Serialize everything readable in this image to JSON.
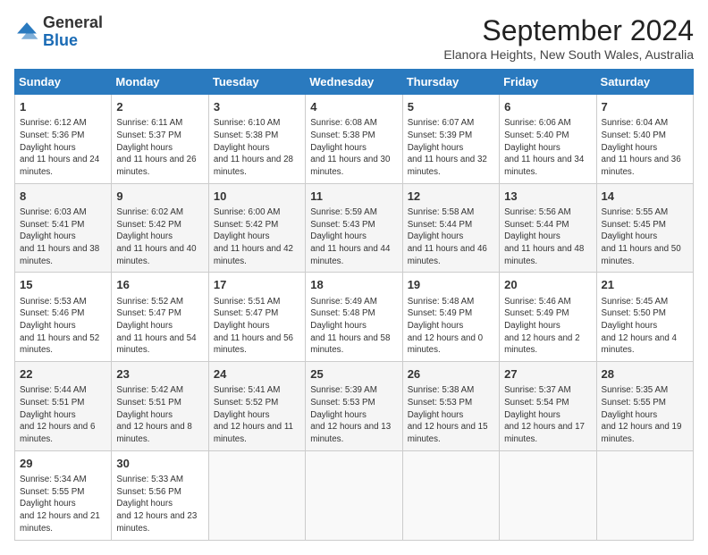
{
  "header": {
    "logo_line1": "General",
    "logo_line2": "Blue",
    "month": "September 2024",
    "location": "Elanora Heights, New South Wales, Australia"
  },
  "weekdays": [
    "Sunday",
    "Monday",
    "Tuesday",
    "Wednesday",
    "Thursday",
    "Friday",
    "Saturday"
  ],
  "weeks": [
    [
      {
        "day": "1",
        "rise": "6:12 AM",
        "set": "5:36 PM",
        "daylight": "11 hours and 24 minutes."
      },
      {
        "day": "2",
        "rise": "6:11 AM",
        "set": "5:37 PM",
        "daylight": "11 hours and 26 minutes."
      },
      {
        "day": "3",
        "rise": "6:10 AM",
        "set": "5:38 PM",
        "daylight": "11 hours and 28 minutes."
      },
      {
        "day": "4",
        "rise": "6:08 AM",
        "set": "5:38 PM",
        "daylight": "11 hours and 30 minutes."
      },
      {
        "day": "5",
        "rise": "6:07 AM",
        "set": "5:39 PM",
        "daylight": "11 hours and 32 minutes."
      },
      {
        "day": "6",
        "rise": "6:06 AM",
        "set": "5:40 PM",
        "daylight": "11 hours and 34 minutes."
      },
      {
        "day": "7",
        "rise": "6:04 AM",
        "set": "5:40 PM",
        "daylight": "11 hours and 36 minutes."
      }
    ],
    [
      {
        "day": "8",
        "rise": "6:03 AM",
        "set": "5:41 PM",
        "daylight": "11 hours and 38 minutes."
      },
      {
        "day": "9",
        "rise": "6:02 AM",
        "set": "5:42 PM",
        "daylight": "11 hours and 40 minutes."
      },
      {
        "day": "10",
        "rise": "6:00 AM",
        "set": "5:42 PM",
        "daylight": "11 hours and 42 minutes."
      },
      {
        "day": "11",
        "rise": "5:59 AM",
        "set": "5:43 PM",
        "daylight": "11 hours and 44 minutes."
      },
      {
        "day": "12",
        "rise": "5:58 AM",
        "set": "5:44 PM",
        "daylight": "11 hours and 46 minutes."
      },
      {
        "day": "13",
        "rise": "5:56 AM",
        "set": "5:44 PM",
        "daylight": "11 hours and 48 minutes."
      },
      {
        "day": "14",
        "rise": "5:55 AM",
        "set": "5:45 PM",
        "daylight": "11 hours and 50 minutes."
      }
    ],
    [
      {
        "day": "15",
        "rise": "5:53 AM",
        "set": "5:46 PM",
        "daylight": "11 hours and 52 minutes."
      },
      {
        "day": "16",
        "rise": "5:52 AM",
        "set": "5:47 PM",
        "daylight": "11 hours and 54 minutes."
      },
      {
        "day": "17",
        "rise": "5:51 AM",
        "set": "5:47 PM",
        "daylight": "11 hours and 56 minutes."
      },
      {
        "day": "18",
        "rise": "5:49 AM",
        "set": "5:48 PM",
        "daylight": "11 hours and 58 minutes."
      },
      {
        "day": "19",
        "rise": "5:48 AM",
        "set": "5:49 PM",
        "daylight": "12 hours and 0 minutes."
      },
      {
        "day": "20",
        "rise": "5:46 AM",
        "set": "5:49 PM",
        "daylight": "12 hours and 2 minutes."
      },
      {
        "day": "21",
        "rise": "5:45 AM",
        "set": "5:50 PM",
        "daylight": "12 hours and 4 minutes."
      }
    ],
    [
      {
        "day": "22",
        "rise": "5:44 AM",
        "set": "5:51 PM",
        "daylight": "12 hours and 6 minutes."
      },
      {
        "day": "23",
        "rise": "5:42 AM",
        "set": "5:51 PM",
        "daylight": "12 hours and 8 minutes."
      },
      {
        "day": "24",
        "rise": "5:41 AM",
        "set": "5:52 PM",
        "daylight": "12 hours and 11 minutes."
      },
      {
        "day": "25",
        "rise": "5:39 AM",
        "set": "5:53 PM",
        "daylight": "12 hours and 13 minutes."
      },
      {
        "day": "26",
        "rise": "5:38 AM",
        "set": "5:53 PM",
        "daylight": "12 hours and 15 minutes."
      },
      {
        "day": "27",
        "rise": "5:37 AM",
        "set": "5:54 PM",
        "daylight": "12 hours and 17 minutes."
      },
      {
        "day": "28",
        "rise": "5:35 AM",
        "set": "5:55 PM",
        "daylight": "12 hours and 19 minutes."
      }
    ],
    [
      {
        "day": "29",
        "rise": "5:34 AM",
        "set": "5:55 PM",
        "daylight": "12 hours and 21 minutes."
      },
      {
        "day": "30",
        "rise": "5:33 AM",
        "set": "5:56 PM",
        "daylight": "12 hours and 23 minutes."
      },
      null,
      null,
      null,
      null,
      null
    ]
  ]
}
